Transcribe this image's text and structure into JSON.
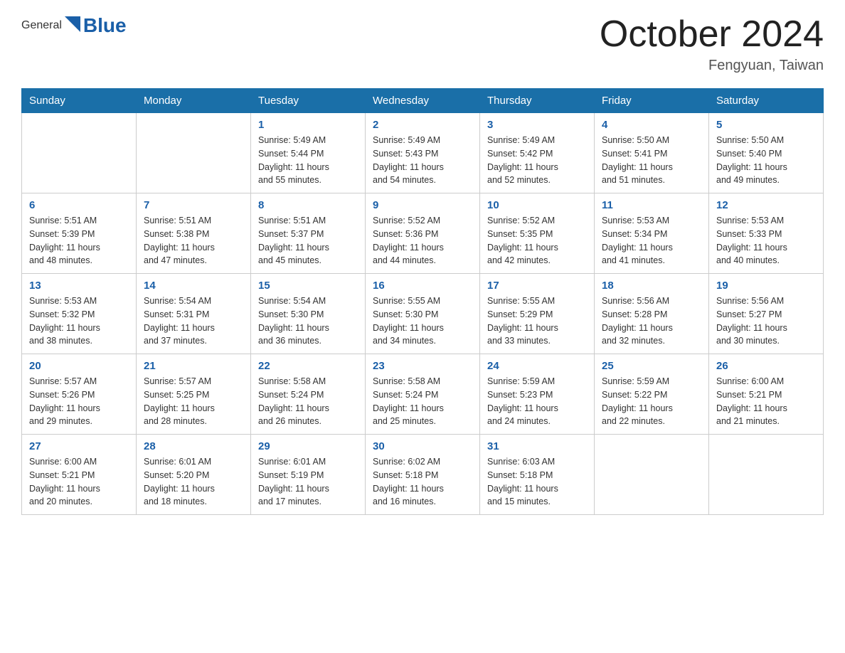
{
  "header": {
    "logo": {
      "general": "General",
      "blue": "Blue"
    },
    "title": "October 2024",
    "subtitle": "Fengyuan, Taiwan"
  },
  "calendar": {
    "days_of_week": [
      "Sunday",
      "Monday",
      "Tuesday",
      "Wednesday",
      "Thursday",
      "Friday",
      "Saturday"
    ],
    "weeks": [
      [
        {
          "day": "",
          "info": ""
        },
        {
          "day": "",
          "info": ""
        },
        {
          "day": "1",
          "info": "Sunrise: 5:49 AM\nSunset: 5:44 PM\nDaylight: 11 hours\nand 55 minutes."
        },
        {
          "day": "2",
          "info": "Sunrise: 5:49 AM\nSunset: 5:43 PM\nDaylight: 11 hours\nand 54 minutes."
        },
        {
          "day": "3",
          "info": "Sunrise: 5:49 AM\nSunset: 5:42 PM\nDaylight: 11 hours\nand 52 minutes."
        },
        {
          "day": "4",
          "info": "Sunrise: 5:50 AM\nSunset: 5:41 PM\nDaylight: 11 hours\nand 51 minutes."
        },
        {
          "day": "5",
          "info": "Sunrise: 5:50 AM\nSunset: 5:40 PM\nDaylight: 11 hours\nand 49 minutes."
        }
      ],
      [
        {
          "day": "6",
          "info": "Sunrise: 5:51 AM\nSunset: 5:39 PM\nDaylight: 11 hours\nand 48 minutes."
        },
        {
          "day": "7",
          "info": "Sunrise: 5:51 AM\nSunset: 5:38 PM\nDaylight: 11 hours\nand 47 minutes."
        },
        {
          "day": "8",
          "info": "Sunrise: 5:51 AM\nSunset: 5:37 PM\nDaylight: 11 hours\nand 45 minutes."
        },
        {
          "day": "9",
          "info": "Sunrise: 5:52 AM\nSunset: 5:36 PM\nDaylight: 11 hours\nand 44 minutes."
        },
        {
          "day": "10",
          "info": "Sunrise: 5:52 AM\nSunset: 5:35 PM\nDaylight: 11 hours\nand 42 minutes."
        },
        {
          "day": "11",
          "info": "Sunrise: 5:53 AM\nSunset: 5:34 PM\nDaylight: 11 hours\nand 41 minutes."
        },
        {
          "day": "12",
          "info": "Sunrise: 5:53 AM\nSunset: 5:33 PM\nDaylight: 11 hours\nand 40 minutes."
        }
      ],
      [
        {
          "day": "13",
          "info": "Sunrise: 5:53 AM\nSunset: 5:32 PM\nDaylight: 11 hours\nand 38 minutes."
        },
        {
          "day": "14",
          "info": "Sunrise: 5:54 AM\nSunset: 5:31 PM\nDaylight: 11 hours\nand 37 minutes."
        },
        {
          "day": "15",
          "info": "Sunrise: 5:54 AM\nSunset: 5:30 PM\nDaylight: 11 hours\nand 36 minutes."
        },
        {
          "day": "16",
          "info": "Sunrise: 5:55 AM\nSunset: 5:30 PM\nDaylight: 11 hours\nand 34 minutes."
        },
        {
          "day": "17",
          "info": "Sunrise: 5:55 AM\nSunset: 5:29 PM\nDaylight: 11 hours\nand 33 minutes."
        },
        {
          "day": "18",
          "info": "Sunrise: 5:56 AM\nSunset: 5:28 PM\nDaylight: 11 hours\nand 32 minutes."
        },
        {
          "day": "19",
          "info": "Sunrise: 5:56 AM\nSunset: 5:27 PM\nDaylight: 11 hours\nand 30 minutes."
        }
      ],
      [
        {
          "day": "20",
          "info": "Sunrise: 5:57 AM\nSunset: 5:26 PM\nDaylight: 11 hours\nand 29 minutes."
        },
        {
          "day": "21",
          "info": "Sunrise: 5:57 AM\nSunset: 5:25 PM\nDaylight: 11 hours\nand 28 minutes."
        },
        {
          "day": "22",
          "info": "Sunrise: 5:58 AM\nSunset: 5:24 PM\nDaylight: 11 hours\nand 26 minutes."
        },
        {
          "day": "23",
          "info": "Sunrise: 5:58 AM\nSunset: 5:24 PM\nDaylight: 11 hours\nand 25 minutes."
        },
        {
          "day": "24",
          "info": "Sunrise: 5:59 AM\nSunset: 5:23 PM\nDaylight: 11 hours\nand 24 minutes."
        },
        {
          "day": "25",
          "info": "Sunrise: 5:59 AM\nSunset: 5:22 PM\nDaylight: 11 hours\nand 22 minutes."
        },
        {
          "day": "26",
          "info": "Sunrise: 6:00 AM\nSunset: 5:21 PM\nDaylight: 11 hours\nand 21 minutes."
        }
      ],
      [
        {
          "day": "27",
          "info": "Sunrise: 6:00 AM\nSunset: 5:21 PM\nDaylight: 11 hours\nand 20 minutes."
        },
        {
          "day": "28",
          "info": "Sunrise: 6:01 AM\nSunset: 5:20 PM\nDaylight: 11 hours\nand 18 minutes."
        },
        {
          "day": "29",
          "info": "Sunrise: 6:01 AM\nSunset: 5:19 PM\nDaylight: 11 hours\nand 17 minutes."
        },
        {
          "day": "30",
          "info": "Sunrise: 6:02 AM\nSunset: 5:18 PM\nDaylight: 11 hours\nand 16 minutes."
        },
        {
          "day": "31",
          "info": "Sunrise: 6:03 AM\nSunset: 5:18 PM\nDaylight: 11 hours\nand 15 minutes."
        },
        {
          "day": "",
          "info": ""
        },
        {
          "day": "",
          "info": ""
        }
      ]
    ]
  }
}
